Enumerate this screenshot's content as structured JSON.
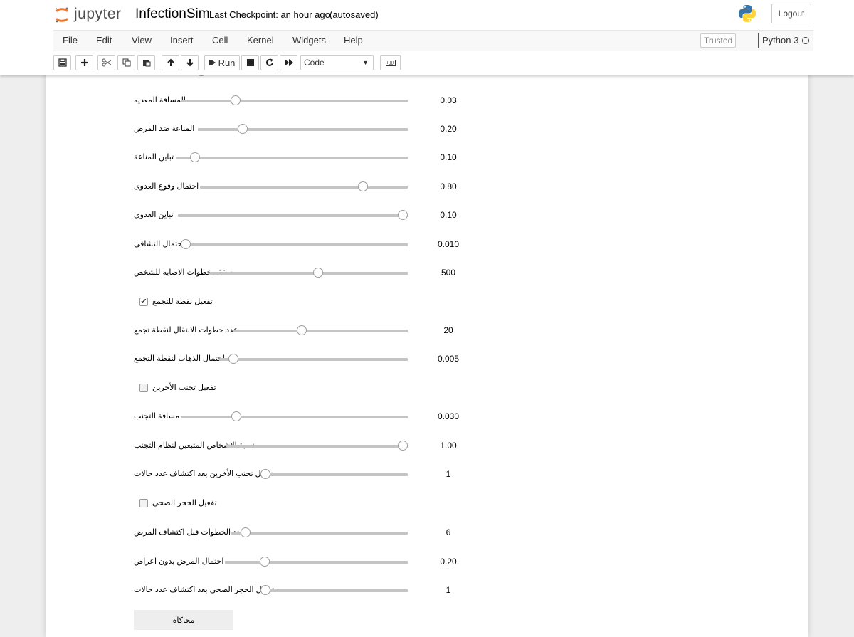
{
  "header": {
    "logo_text": "jupyter",
    "notebook_name": "InfectionSim",
    "checkpoint": "Last Checkpoint: an hour ago",
    "autosave": "(autosaved)",
    "logout": "Logout"
  },
  "menubar": {
    "items": [
      "File",
      "Edit",
      "View",
      "Insert",
      "Cell",
      "Kernel",
      "Widgets",
      "Help"
    ],
    "trusted": "Trusted",
    "kernel": "Python 3"
  },
  "toolbar": {
    "run_label": "Run",
    "cell_type": "Code",
    "icons": [
      "save-icon",
      "plus-icon",
      "cut-icon",
      "copy-icon",
      "paste-icon",
      "arrow-up-icon",
      "arrow-down-icon",
      "stop-icon",
      "restart-icon",
      "fast-forward-icon",
      "keyboard-icon"
    ]
  },
  "widgets": {
    "sliders": [
      {
        "label": "المسافة المعديه",
        "value": "0.03",
        "fraction": 0.23
      },
      {
        "label": "المناعة ضد المرض",
        "value": "0.20",
        "fraction": 0.2
      },
      {
        "label": "تباين المناعة",
        "value": "0.10",
        "fraction": 0.06
      },
      {
        "label": "احتمال وقوع العدوى",
        "value": "0.80",
        "fraction": 0.8
      },
      {
        "label": "تباين العدوى",
        "value": "0.10",
        "fraction": 1.0
      },
      {
        "label": "احتمال التشافي",
        "value": "0.010",
        "fraction": 0.0
      },
      {
        "label": "سقف خطوات الاصابه للشخص",
        "value": "500",
        "fraction": 0.55
      },
      {
        "label": "عدد خطوات الانتقال لنقطة تجمع",
        "value": "20",
        "fraction": 0.39
      },
      {
        "label": "احتمال الذهاب لنقطة التجمع",
        "value": "0.005",
        "fraction": 0.05
      },
      {
        "label": "مسافة التجنب",
        "value": "0.030",
        "fraction": 0.23
      },
      {
        "label": "نسبة الاشخاص المتبعين لنظام التجنب",
        "value": "1.00",
        "fraction": 1.0
      },
      {
        "label": "تفعيل تجنب الأخرين بعد اكتشاف عدد حالات",
        "value": "1",
        "fraction": 0.0
      },
      {
        "label": "عدد الخطوات قبل اكتشاف المرض",
        "value": "6",
        "fraction": 0.06
      },
      {
        "label": "احتمال المرض بدون اعراض",
        "value": "0.20",
        "fraction": 0.2
      },
      {
        "label": "تفعيل الحجر الصحي بعد اكتشاف عدد حالات",
        "value": "1",
        "fraction": 0.0
      }
    ],
    "checkboxes": [
      {
        "label": "تفعيل نقطة للتجمع",
        "checked": true
      },
      {
        "label": "تفعيل تجنب الأخرين",
        "checked": false
      },
      {
        "label": "تفعيل الحجر الصحي",
        "checked": false
      }
    ],
    "button": "محاكاه"
  }
}
